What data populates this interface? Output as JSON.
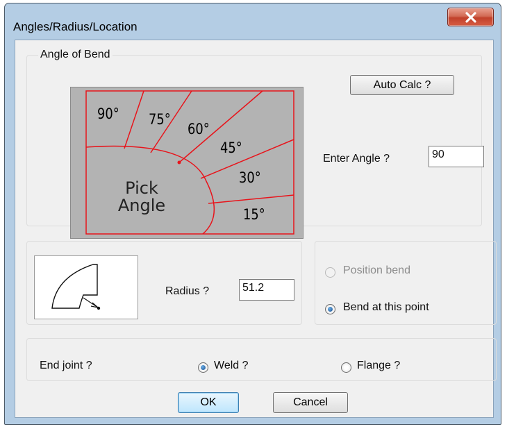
{
  "window": {
    "title": "Angles/Radius/Location"
  },
  "angle_group": {
    "label": "Angle of Bend",
    "picker": {
      "angles": [
        "90°",
        "75°",
        "60°",
        "45°",
        "30°",
        "15°"
      ],
      "center_text_line1": "Pick",
      "center_text_line2": "Angle",
      "border_color": "#e8141b",
      "fill_color": "#b3b3b3"
    },
    "auto_calc_label": "Auto Calc ?",
    "enter_angle_label": "Enter Angle ?",
    "enter_angle_value": "90"
  },
  "radius_group": {
    "radius_label": "Radius ?",
    "radius_value": "51.2"
  },
  "location_group": {
    "position_bend_label": "Position bend",
    "bend_at_point_label": "Bend at this point",
    "selected": "Bend at this point"
  },
  "end_joint_group": {
    "label": "End joint ?",
    "weld_label": "Weld ?",
    "flange_label": "Flange ?",
    "selected": "Weld ?"
  },
  "buttons": {
    "ok_label": "OK",
    "cancel_label": "Cancel"
  },
  "colors": {
    "title_bar": "#b4cde4",
    "close_button": "#c7452f",
    "dialog_bg": "#f0f0f0"
  },
  "icons": {
    "close": "close-icon",
    "bend_preview": "pipe-bend-icon"
  }
}
